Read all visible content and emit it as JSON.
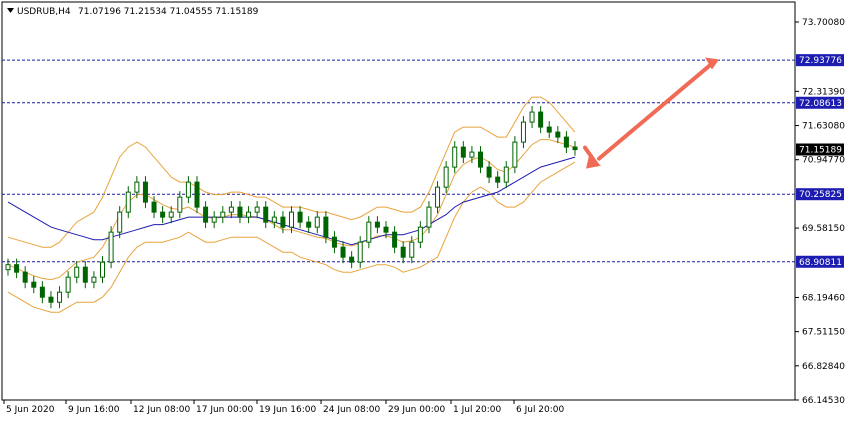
{
  "header": {
    "symbol": "USDRUB,H4",
    "ohlc": "71.07196 71.21534 71.04555 71.15189"
  },
  "colors": {
    "background": "#ffffff",
    "candle": "#006400",
    "bollinger": "#e8a33a",
    "moving_average": "#1c1cb0",
    "level_line": "#1c1ca0",
    "level_label_bg": "#1c1cb0",
    "price_label_bg": "#000000",
    "arrow": "#f06a56"
  },
  "chart_data": {
    "type": "candlestick",
    "instrument": "USDRUB",
    "timeframe": "H4",
    "ylim": [
      66.1453,
      74.1
    ],
    "yticks": [
      "73.70080",
      "72.31390",
      "71.63080",
      "70.94770",
      "69.58150",
      "68.19460",
      "67.51150",
      "66.82840",
      "66.14530"
    ],
    "xticks": [
      "5 Jun 2020",
      "9 Jun 16:00",
      "12 Jun 08:00",
      "17 Jun 00:00",
      "19 Jun 16:00",
      "24 Jun 08:00",
      "29 Jun 00:00",
      "1 Jul 20:00",
      "6 Jul 20:00"
    ],
    "level_labels": [
      "72.93776",
      "72.08613",
      "70.25825",
      "68.90811"
    ],
    "levels": [
      72.93776,
      72.08613,
      70.25825,
      68.90811
    ],
    "current_price_label": "71.15189",
    "current_price": 71.15189,
    "close_series": [
      68.85,
      68.7,
      68.5,
      68.4,
      68.2,
      68.1,
      68.3,
      68.6,
      68.8,
      68.5,
      68.6,
      68.9,
      69.5,
      69.9,
      70.3,
      70.5,
      70.1,
      69.9,
      69.8,
      69.9,
      70.2,
      70.5,
      70.0,
      69.7,
      69.8,
      69.9,
      70.0,
      69.8,
      69.9,
      70.0,
      69.7,
      69.8,
      69.6,
      69.9,
      69.7,
      69.6,
      69.8,
      69.4,
      69.2,
      69.0,
      68.9,
      69.3,
      69.7,
      69.6,
      69.5,
      69.2,
      69.0,
      69.3,
      69.6,
      70.0,
      70.4,
      70.8,
      71.2,
      71.0,
      71.1,
      70.8,
      70.6,
      70.5,
      70.8,
      71.3,
      71.7,
      71.9,
      71.6,
      71.5,
      71.4,
      71.2,
      71.15
    ],
    "upper_band": [
      69.4,
      69.35,
      69.3,
      69.25,
      69.2,
      69.2,
      69.3,
      69.5,
      69.7,
      69.8,
      69.9,
      70.2,
      70.6,
      71.0,
      71.2,
      71.3,
      71.2,
      71.0,
      70.8,
      70.6,
      70.5,
      70.5,
      70.4,
      70.3,
      70.25,
      70.25,
      70.3,
      70.3,
      70.25,
      70.2,
      70.2,
      70.1,
      70.0,
      70.0,
      70.0,
      69.95,
      69.9,
      69.9,
      69.85,
      69.8,
      69.75,
      69.8,
      69.9,
      70.0,
      70.0,
      69.95,
      69.9,
      69.9,
      70.0,
      70.3,
      70.7,
      71.1,
      71.5,
      71.6,
      71.6,
      71.6,
      71.5,
      71.4,
      71.4,
      71.7,
      72.0,
      72.2,
      72.2,
      72.1,
      71.9,
      71.7,
      71.5
    ],
    "lower_band": [
      68.3,
      68.2,
      68.1,
      68.0,
      67.95,
      67.9,
      67.9,
      68.0,
      68.1,
      68.1,
      68.1,
      68.2,
      68.4,
      68.7,
      69.0,
      69.2,
      69.3,
      69.3,
      69.3,
      69.35,
      69.4,
      69.5,
      69.4,
      69.3,
      69.3,
      69.35,
      69.4,
      69.4,
      69.4,
      69.4,
      69.3,
      69.2,
      69.1,
      69.1,
      69.0,
      68.95,
      68.9,
      68.85,
      68.75,
      68.7,
      68.7,
      68.75,
      68.8,
      68.85,
      68.85,
      68.8,
      68.7,
      68.75,
      68.8,
      68.9,
      69.0,
      69.4,
      69.8,
      70.1,
      70.3,
      70.4,
      70.3,
      70.1,
      70.0,
      70.0,
      70.1,
      70.3,
      70.5,
      70.6,
      70.7,
      70.8,
      70.9
    ],
    "moving_average": [
      70.1,
      70.0,
      69.9,
      69.8,
      69.7,
      69.6,
      69.55,
      69.5,
      69.45,
      69.4,
      69.35,
      69.35,
      69.4,
      69.45,
      69.5,
      69.55,
      69.6,
      69.65,
      69.65,
      69.7,
      69.75,
      69.8,
      69.8,
      69.8,
      69.8,
      69.8,
      69.8,
      69.8,
      69.8,
      69.8,
      69.75,
      69.7,
      69.65,
      69.6,
      69.55,
      69.5,
      69.45,
      69.4,
      69.35,
      69.3,
      69.25,
      69.3,
      69.35,
      69.4,
      69.45,
      69.45,
      69.45,
      69.5,
      69.55,
      69.65,
      69.75,
      69.85,
      70.0,
      70.1,
      70.15,
      70.2,
      70.25,
      70.3,
      70.4,
      70.5,
      70.6,
      70.7,
      70.8,
      70.85,
      70.9,
      70.95,
      71.0
    ],
    "arrows": [
      {
        "from": [
          70.85,
          71.2
        ],
        "to": [
          57,
          70.85
        ]
      },
      {
        "from": [
          59,
          70.85
        ],
        "to": [
          68,
          72.95
        ]
      }
    ]
  }
}
